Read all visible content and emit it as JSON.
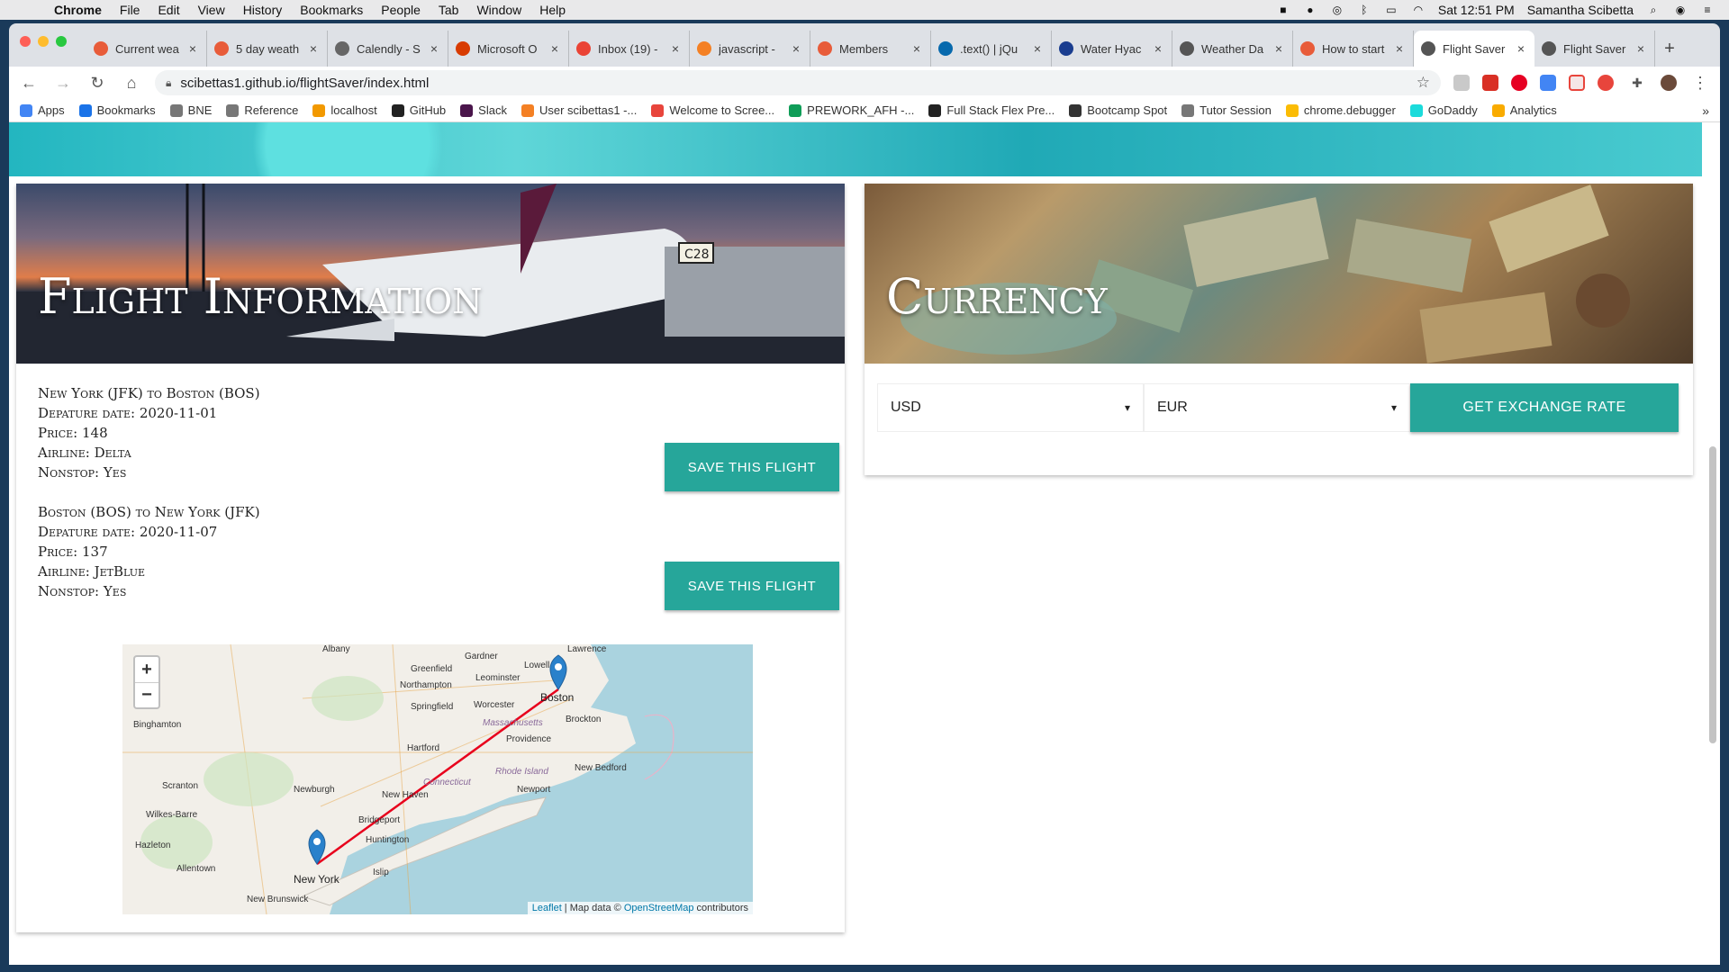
{
  "menubar": {
    "app": "Chrome",
    "items": [
      "File",
      "Edit",
      "View",
      "History",
      "Bookmarks",
      "People",
      "Tab",
      "Window",
      "Help"
    ],
    "clock": "Sat 12:51 PM",
    "user": "Samantha Scibetta"
  },
  "tabs": [
    {
      "label": "Current wea",
      "color": "#e85c3a"
    },
    {
      "label": "5 day weath",
      "color": "#e85c3a"
    },
    {
      "label": "Calendly - S",
      "color": "#666666"
    },
    {
      "label": "Microsoft O",
      "color": "#d83b01"
    },
    {
      "label": "Inbox (19) -",
      "color": "#ea4335"
    },
    {
      "label": "javascript -",
      "color": "#f48024"
    },
    {
      "label": "Members",
      "color": "#e85c3a"
    },
    {
      "label": ".text() | jQu",
      "color": "#0769ad"
    },
    {
      "label": "Water Hyac",
      "color": "#1a3d8f"
    },
    {
      "label": "Weather Da",
      "color": "#555555"
    },
    {
      "label": "How to start",
      "color": "#e85c3a"
    },
    {
      "label": "Flight Saver",
      "color": "#555555",
      "active": true
    },
    {
      "label": "Flight Saver",
      "color": "#555555"
    }
  ],
  "address": "scibettas1.github.io/flightSaver/index.html",
  "bookmarks": [
    {
      "label": "Apps",
      "color": "#4285f4"
    },
    {
      "label": "Bookmarks",
      "color": "#1a73e8"
    },
    {
      "label": "BNE",
      "color": "#777777"
    },
    {
      "label": "Reference",
      "color": "#777777"
    },
    {
      "label": "localhost",
      "color": "#f29900"
    },
    {
      "label": "GitHub",
      "color": "#222222"
    },
    {
      "label": "Slack",
      "color": "#4a154b"
    },
    {
      "label": "User scibettas1 -...",
      "color": "#f48024"
    },
    {
      "label": "Welcome to Scree...",
      "color": "#e8453c"
    },
    {
      "label": "PREWORK_AFH -...",
      "color": "#0f9d58"
    },
    {
      "label": "Full Stack Flex Pre...",
      "color": "#222222"
    },
    {
      "label": "Bootcamp Spot",
      "color": "#333333"
    },
    {
      "label": "Tutor Session",
      "color": "#777777"
    },
    {
      "label": "chrome.debugger",
      "color": "#fbbc05"
    },
    {
      "label": "GoDaddy",
      "color": "#1bdbdb"
    },
    {
      "label": "Analytics",
      "color": "#f9ab00"
    }
  ],
  "flight_section": {
    "title": "Flight Information",
    "flights": [
      {
        "route": "New York (JFK) to Boston (BOS)",
        "date": "Depature date: 2020-11-01",
        "price": "Price: 148",
        "airline": "Airline: Delta",
        "nonstop": "Nonstop: Yes",
        "button": "Save This Flight"
      },
      {
        "route": "Boston (BOS) to New York (JFK)",
        "date": "Depature date: 2020-11-07",
        "price": "Price: 137",
        "airline": "Airline: JetBlue",
        "nonstop": "Nonstop: Yes",
        "button": "Save This Flight"
      }
    ]
  },
  "map": {
    "zoom_in": "+",
    "zoom_out": "−",
    "attribution_leaflet": "Leaflet",
    "attribution_mid": " | Map data © ",
    "attribution_osm": "OpenStreetMap",
    "attribution_end": " contributors",
    "labels": [
      "Albany",
      "Greenfield",
      "Gardner",
      "Lowell",
      "Lawrence",
      "Northampton",
      "Leominster",
      "Worcester",
      "Boston",
      "Springfield",
      "Massachusetts",
      "Brockton",
      "Binghamton",
      "Hartford",
      "Providence",
      "New Bedford",
      "Rhode Island",
      "Newburgh",
      "Connecticut",
      "New Haven",
      "Newport",
      "Scranton",
      "Wilkes-Barre",
      "Bridgeport",
      "Hazleton",
      "Huntington",
      "Allentown",
      "New York",
      "Islip",
      "New Brunswick"
    ]
  },
  "currency_section": {
    "title": "Currency",
    "from": "USD",
    "to": "EUR",
    "button": "Get Exchange Rate"
  }
}
